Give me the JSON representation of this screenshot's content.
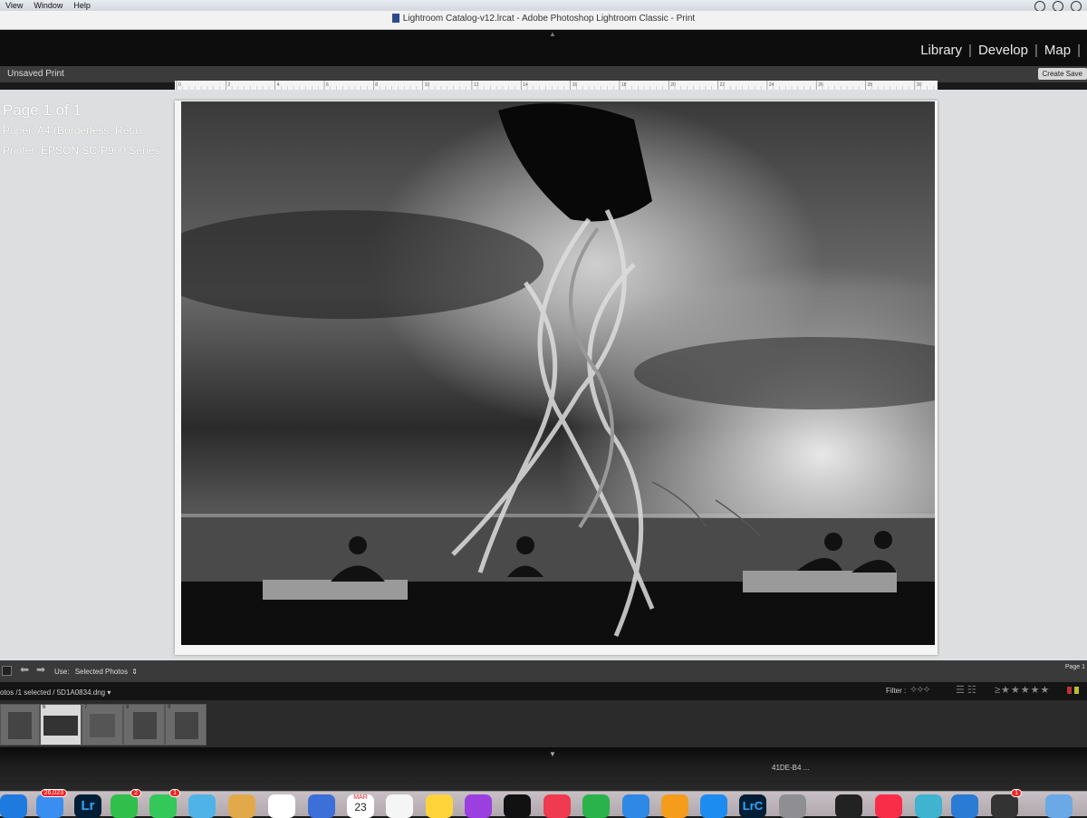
{
  "menubar": {
    "items": [
      "View",
      "Window",
      "Help"
    ]
  },
  "titlebar": {
    "title": "Lightroom Catalog-v12.lrcat - Adobe Photoshop Lightroom Classic - Print"
  },
  "modules": [
    "Library",
    "Develop",
    "Map"
  ],
  "toolbar": {
    "unsaved": "Unsaved Print",
    "create_saved": "Create Save"
  },
  "ruler": {
    "ticks": [
      "0",
      "2",
      "4",
      "6",
      "8",
      "10",
      "12",
      "14",
      "16",
      "18",
      "20",
      "22",
      "24",
      "26",
      "28",
      "30"
    ]
  },
  "page_info": {
    "page": "Page 1 of 1",
    "paper": "Paper:  A4 (Borderless, Reta...",
    "printer": "Printer:  EPSON SC-P900 Series"
  },
  "bottom": {
    "use_label": "Use:",
    "use_value": "Selected Photos",
    "page_label": "Page 1"
  },
  "filmstrip": {
    "count": "otos /1 selected /",
    "filename": "5D1A0834.dng",
    "filter_label": "Filter :",
    "thumbs": [
      {
        "num": ""
      },
      {
        "num": "6"
      },
      {
        "num": "7"
      },
      {
        "num": "8"
      },
      {
        "num": "9"
      }
    ]
  },
  "desk": {
    "code": "41DE-B4 ..."
  },
  "dock": {
    "mail_badge": "26,023",
    "facetime_badge": "2",
    "messages_badge": "1",
    "calendar_month": "MAR",
    "calendar_day": "23",
    "misc_badge": "1",
    "lr_label": "Lr",
    "lrc_label": "LrC"
  },
  "colors": {
    "lr_dark": "#0d0d0d",
    "work_bg": "#dcdedf",
    "accent_blue": "#0a84ff"
  }
}
